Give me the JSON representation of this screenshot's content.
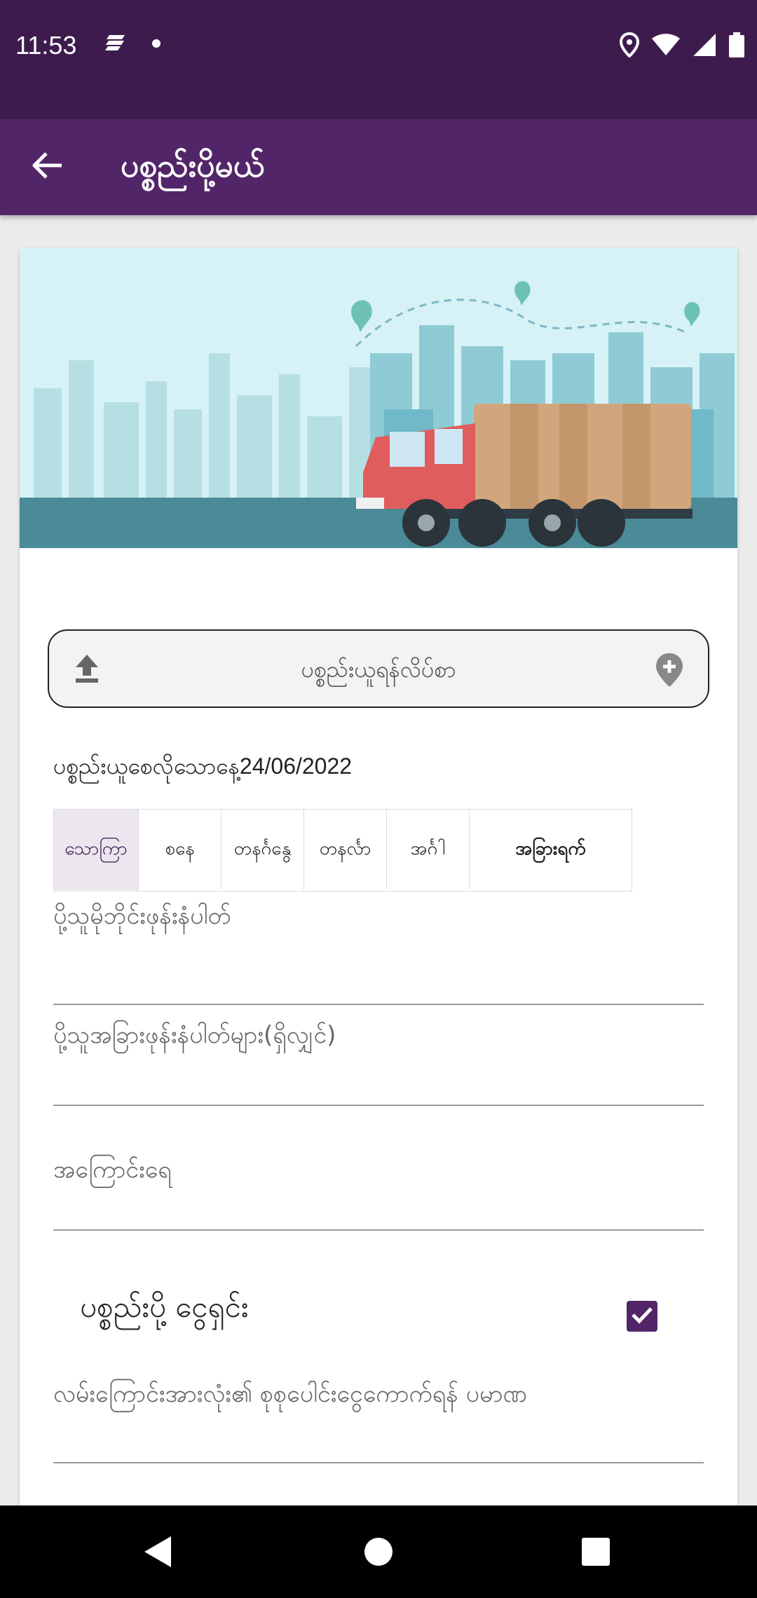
{
  "status_bar": {
    "time": "11:53",
    "left_icons": [
      "notes-icon",
      "dot-icon"
    ],
    "right_icons": [
      "location-icon",
      "wifi-icon",
      "signal-icon",
      "battery-icon"
    ]
  },
  "app_bar": {
    "title": "ပစ္စည်းပို့မယ်",
    "back_icon": "arrow-left-icon"
  },
  "hero": {
    "description_icon": "delivery-truck-illustration"
  },
  "upload": {
    "label": "ပစ္စည်းယူရန်လိပ်စာ",
    "left_icon": "upload-icon",
    "right_icon": "add-circle-icon"
  },
  "pickup_date": {
    "label": "ပစ္စည်းယူစေလိုသောနေ့",
    "value": "24/06/2022"
  },
  "day_tabs": [
    {
      "label": "သောကြာ"
    },
    {
      "label": "စနေ"
    },
    {
      "label": "တနင်္ဂနွေ"
    },
    {
      "label": "တနင်္လာ"
    },
    {
      "label": "အင်္ဂါ"
    },
    {
      "label": "အခြားရက်"
    }
  ],
  "fields": {
    "sender_phone": {
      "placeholder": "ပို့သူမိုဘိုင်းဖုန်းနံပါတ်"
    },
    "sender_other_phone": {
      "placeholder": "ပို့သူအခြားဖုန်းနံပါတ်များ(ရှိလျှင်)"
    },
    "address": {
      "placeholder": "အကြောင်းရေ"
    },
    "total_amount": {
      "placeholder": "လမ်းကြောင်းအားလုံး၏ စုစုပေါင်းငွေကောက်ရန် ပမာဏ"
    }
  },
  "cod": {
    "label": "ပစ္စည်းပို့ ငွေရှင်း",
    "checked": true
  },
  "colors": {
    "status_bar": "#3d1c4d",
    "app_bar": "#522569",
    "accent": "#522569"
  },
  "nav_bar": {
    "icons": [
      "back-triangle-icon",
      "home-circle-icon",
      "recents-square-icon"
    ]
  }
}
